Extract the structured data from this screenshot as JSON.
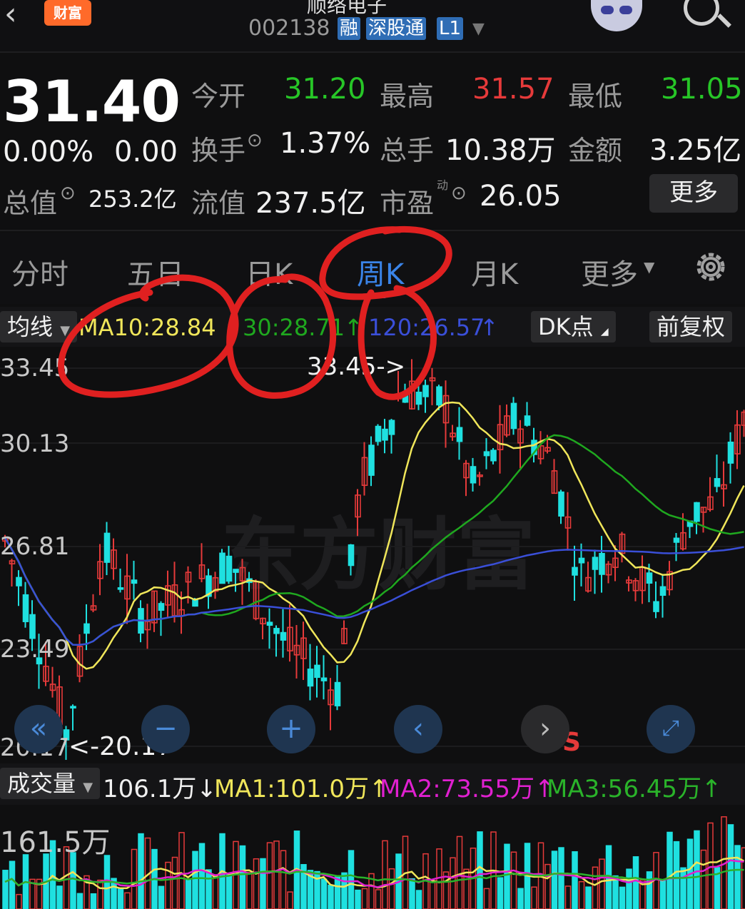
{
  "header": {
    "app_logo": "财富",
    "stock_name": "顺络电子",
    "stock_code": "002138",
    "tags": [
      "融",
      "深股通",
      "L1"
    ],
    "icons": [
      "back-arrow-icon",
      "robot-avatar-icon",
      "search-icon",
      "dropdown-caret-icon"
    ]
  },
  "quote": {
    "price": "31.40",
    "change_pct": "0.00%",
    "change": "0.00",
    "open_label": "今开",
    "open": "31.20",
    "high_label": "最高",
    "high": "31.57",
    "low_label": "最低",
    "low": "31.05",
    "turnover_label": "换手",
    "turnover": "1.37%",
    "volume_label": "总手",
    "volume": "10.38万",
    "amount_label": "金额",
    "amount": "3.25亿",
    "mktcap_label": "总值",
    "mktcap": "253.2亿",
    "float_label": "流值",
    "float": "237.5亿",
    "pe_label": "市盈",
    "pe_sup": "动",
    "pe": "26.05",
    "more": "更多",
    "colors": {
      "up": "#e63a3a",
      "down": "#27c627"
    }
  },
  "tabs": [
    "分时",
    "五日",
    "日K",
    "周K",
    "月K",
    "更多"
  ],
  "active_tab": "周K",
  "ma_bar": {
    "selector": "均线",
    "ma10": "MA10:28.84",
    "ma30": "30:28.71",
    "ma30_arrow": "↑",
    "ma120": "120:26.57",
    "ma120_arrow": "↑",
    "dk": "DK点",
    "adjust": "前复权"
  },
  "kline": {
    "y_labels": [
      "33.45",
      "30.13",
      "26.81",
      "23.49",
      "20.17"
    ],
    "max_marker": "33.45->",
    "min_marker": "<-20.17",
    "sell_marker": "S",
    "watermark": "东方财富",
    "colors": {
      "up": "#e63a3a",
      "down": "#1fe0e0",
      "ma10": "#f0e65a",
      "ma30": "#1fa81f",
      "ma120": "#3a4fd8"
    }
  },
  "nav_buttons": [
    "double-left-icon",
    "minus-icon",
    "plus-icon",
    "chevron-left-icon",
    "chevron-right-icon",
    "expand-icon"
  ],
  "volume_bar": {
    "selector": "成交量",
    "vol": "106.1万↓",
    "ma1": "MA1:101.0万↑",
    "ma2": "MA2:73.55万↑",
    "ma3": "MA3:56.45万↑",
    "y_label": "161.5万",
    "colors": {
      "ma1": "#f0e65a",
      "ma2": "#e020d0",
      "ma3": "#2ab32a"
    }
  },
  "annotation": {
    "color": "#e02020"
  }
}
